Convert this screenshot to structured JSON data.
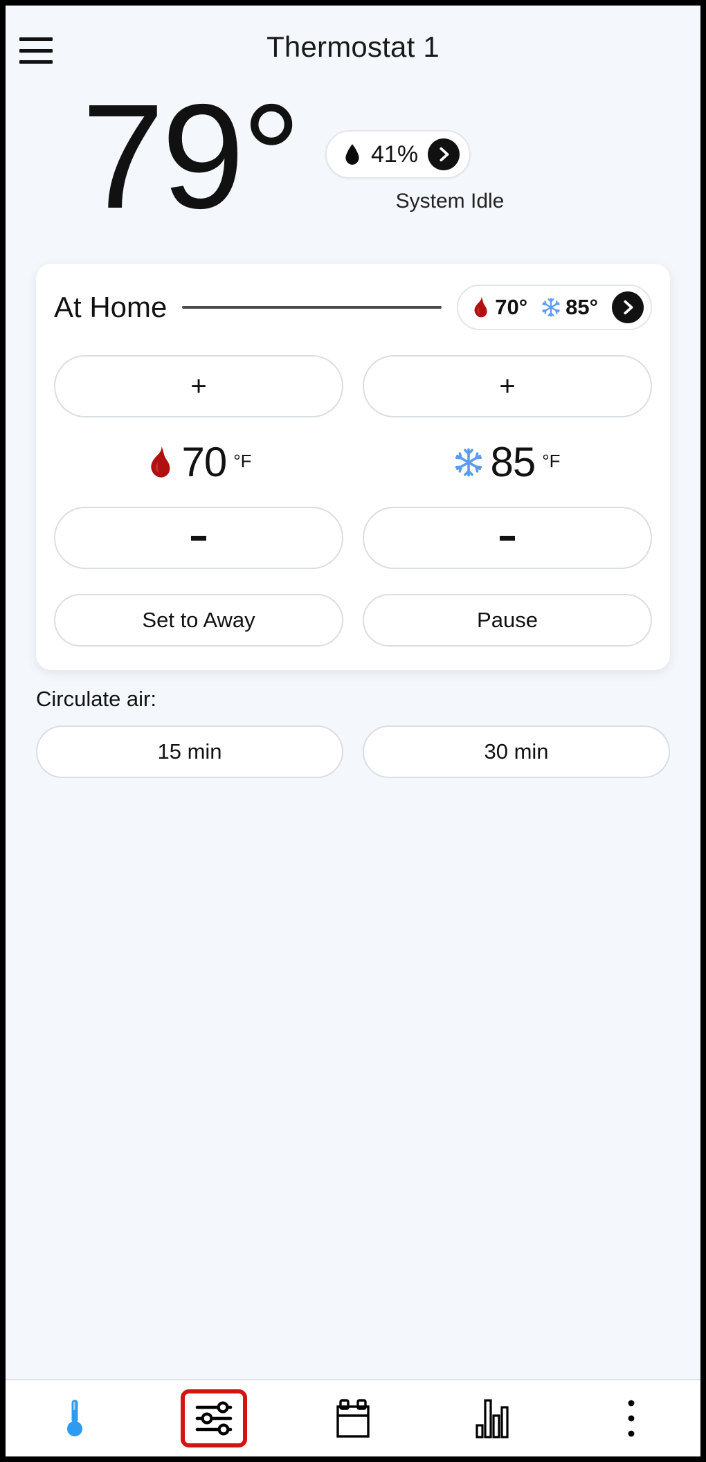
{
  "header": {
    "menu_icon": "hamburger-menu-icon",
    "title": "Thermostat 1"
  },
  "hero": {
    "current_temperature": "79°",
    "humidity_icon": "water-drop-icon",
    "humidity": "41%",
    "humidity_chevron_icon": "chevron-right-icon",
    "system_status": "System Idle"
  },
  "card": {
    "mode_label": "At Home",
    "setpoint_pill": {
      "heat_icon": "flame-icon",
      "heat_value": "70°",
      "cool_icon": "snowflake-icon",
      "cool_value": "85°",
      "chevron_icon": "chevron-right-icon"
    },
    "heat": {
      "increase_label": "+",
      "decrease_label": "-",
      "icon": "flame-icon",
      "value": "70",
      "unit": "°F"
    },
    "cool": {
      "increase_label": "+",
      "decrease_label": "-",
      "icon": "snowflake-icon",
      "value": "85",
      "unit": "°F"
    },
    "actions": {
      "set_to_away": "Set to Away",
      "pause": "Pause"
    }
  },
  "circulate": {
    "label": "Circulate air:",
    "options": [
      "15 min",
      "30 min"
    ]
  },
  "bottom_nav": {
    "items": [
      {
        "name": "thermostat",
        "icon": "thermometer-icon",
        "active": false
      },
      {
        "name": "controls",
        "icon": "sliders-icon",
        "active": true
      },
      {
        "name": "schedule",
        "icon": "calendar-icon",
        "active": false
      },
      {
        "name": "usage",
        "icon": "bar-chart-icon",
        "active": false
      },
      {
        "name": "more",
        "icon": "three-dots-vertical-icon",
        "active": false
      }
    ]
  },
  "colors": {
    "page_background": "#f4f7fb",
    "card_background": "#ffffff",
    "heat_accent": "#b01010",
    "cool_accent": "#5b9bf0",
    "thermometer_accent": "#2e9bf0",
    "active_highlight": "#d31414",
    "text_primary": "#111111",
    "border": "#d9dee4"
  }
}
